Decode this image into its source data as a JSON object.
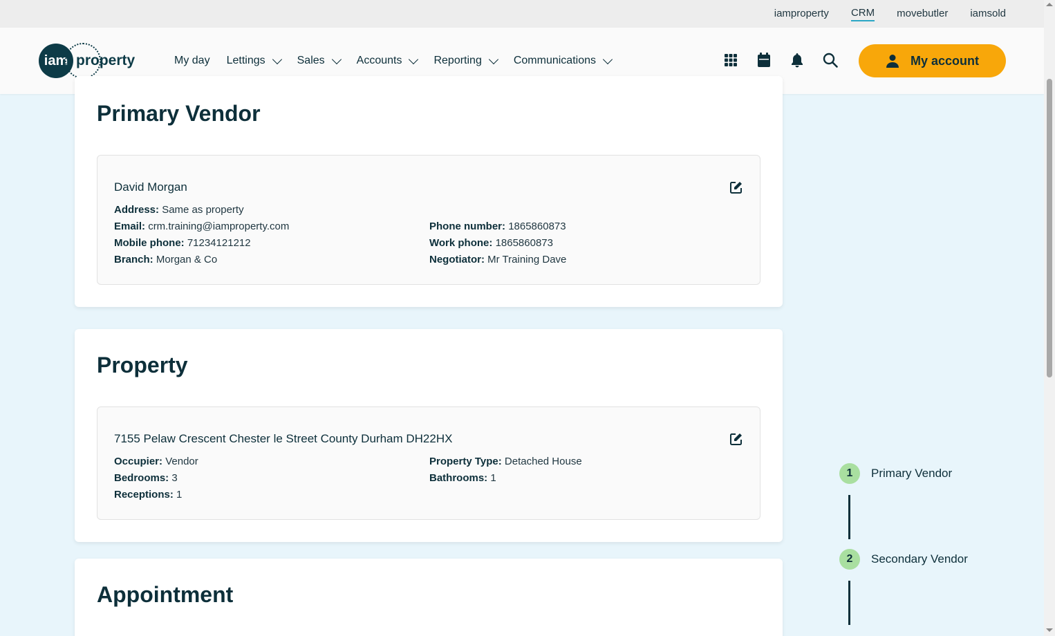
{
  "top_links": [
    "iamproperty",
    "CRM",
    "movebutler",
    "iamsold"
  ],
  "active_top_link": "CRM",
  "logo": {
    "circle_text": "iam",
    "text": "property"
  },
  "nav": {
    "my_day": "My day",
    "lettings": "Lettings",
    "sales": "Sales",
    "accounts": "Accounts",
    "reporting": "Reporting",
    "communications": "Communications"
  },
  "account_button": "My account",
  "primary_vendor": {
    "heading": "Primary Vendor",
    "name": "David Morgan",
    "address_label": "Address:",
    "address": "Same as property",
    "email_label": "Email:",
    "email": "crm.training@iamproperty.com",
    "mobile_label": "Mobile phone:",
    "mobile": "71234121212",
    "branch_label": "Branch:",
    "branch": "Morgan & Co",
    "phone_label": "Phone number:",
    "phone": "1865860873",
    "work_label": "Work phone:",
    "work": "1865860873",
    "negotiator_label": "Negotiator:",
    "negotiator": "Mr Training Dave"
  },
  "property": {
    "heading": "Property",
    "address": "7155 Pelaw Crescent Chester le Street County Durham DH22HX",
    "occupier_label": "Occupier:",
    "occupier": "Vendor",
    "bedrooms_label": "Bedrooms:",
    "bedrooms": "3",
    "receptions_label": "Receptions:",
    "receptions": "1",
    "type_label": "Property Type:",
    "type": "Detached House",
    "bathrooms_label": "Bathrooms:",
    "bathrooms": "1"
  },
  "appointment": {
    "heading": "Appointment"
  },
  "stepper": [
    {
      "num": "1",
      "label": "Primary Vendor"
    },
    {
      "num": "2",
      "label": "Secondary Vendor"
    }
  ],
  "colors": {
    "accent": "#f8a70a",
    "dark": "#0d2f3a",
    "bg": "#e8f5fb",
    "step": "#a9dfa0"
  }
}
